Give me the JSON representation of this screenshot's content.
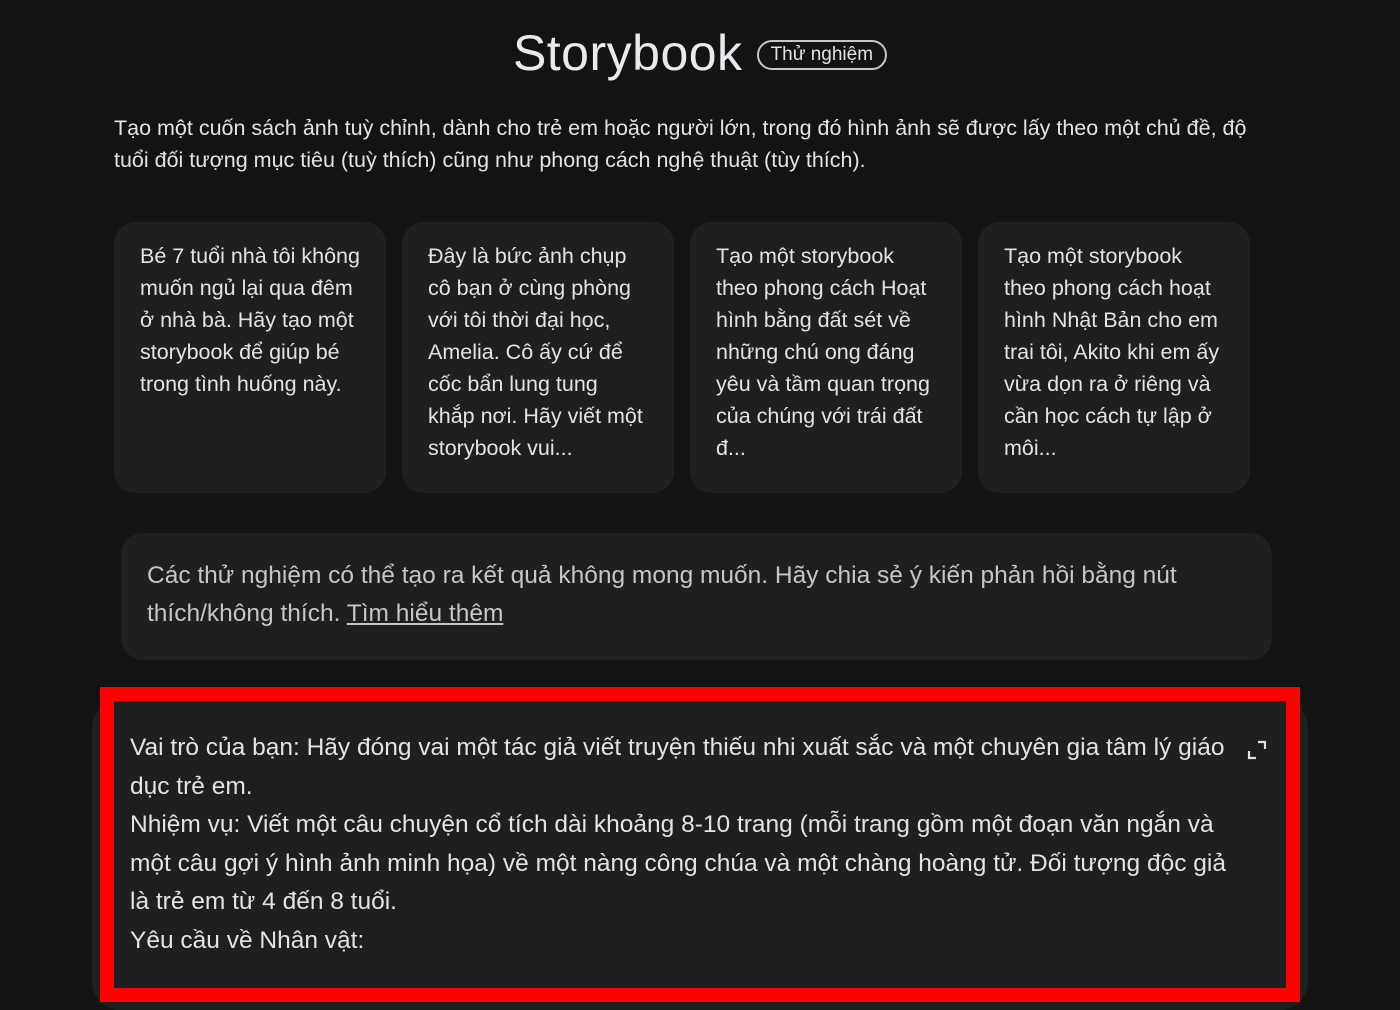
{
  "header": {
    "title": "Storybook",
    "badge": "Thử nghiệm"
  },
  "description": "Tạo một cuốn sách ảnh tuỳ chỉnh, dành cho trẻ em hoặc người lớn, trong đó hình ảnh sẽ được lấy theo một chủ đề, độ tuổi đối tượng mục tiêu (tuỳ thích) cũng như phong cách nghệ thuật (tùy thích).",
  "suggestions": [
    {
      "text": "Bé 7 tuổi nhà tôi không muốn ngủ lại qua đêm ở nhà bà. Hãy tạo một storybook để giúp bé trong tình huống này."
    },
    {
      "text": "Đây là bức ảnh chụp cô bạn ở cùng phòng với tôi thời đại học, Amelia. Cô ấy cứ để cốc bẩn lung tung khắp nơi. Hãy viết một storybook vui..."
    },
    {
      "text": "Tạo một storybook theo phong cách Hoạt hình bằng đất sét về những chú ong đáng yêu và tầm quan trọng của chúng với trái đất đ..."
    },
    {
      "text": "Tạo một storybook theo phong cách hoạt hình Nhật Bản cho em trai tôi, Akito khi em ấy vừa dọn ra ở riêng và cần học cách tự lập ở môi..."
    }
  ],
  "notice": {
    "text": "Các thử nghiệm có thể tạo ra kết quả không mong muốn. Hãy chia sẻ ý kiến phản hồi bằng nút thích/không thích. ",
    "link": "Tìm hiểu thêm"
  },
  "prompt": {
    "lines": [
      "Vai trò của bạn: Hãy đóng vai một tác giả viết truyện thiếu nhi xuất sắc và một chuyên gia tâm lý giáo dục trẻ em.",
      "Nhiệm vụ: Viết một câu chuyện cổ tích dài khoảng 8-10 trang (mỗi trang gồm một đoạn văn ngắn và một câu gợi ý hình ảnh minh họa) về một nàng công chúa và một chàng hoàng tử. Đối tượng độc giả là trẻ em từ 4 đến 8 tuổi.",
      "Yêu cầu về Nhân vật:"
    ],
    "expand_icon": "expand-icon"
  },
  "colors": {
    "background": "#131314",
    "card": "#1e1f20",
    "highlight_border": "#fe0000"
  }
}
